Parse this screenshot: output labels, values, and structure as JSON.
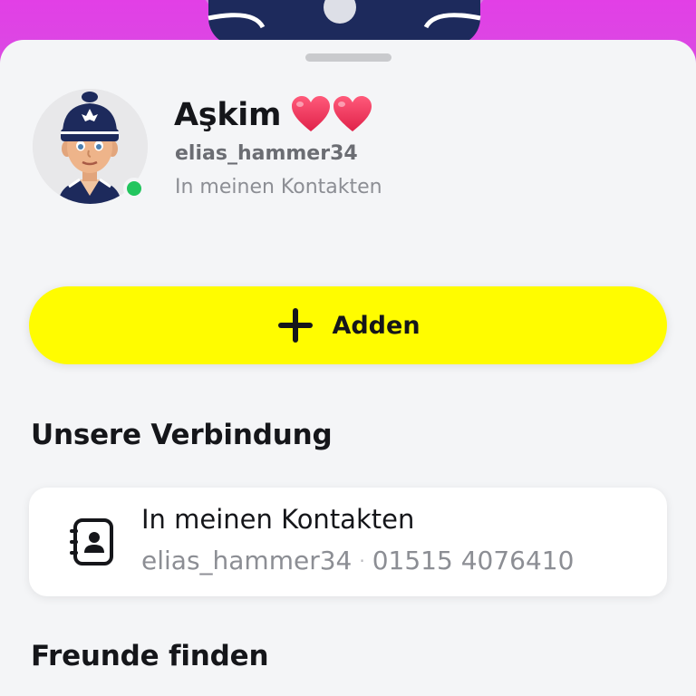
{
  "profile": {
    "display_name": "Aşkim",
    "hearts": "❤️❤️",
    "username": "elias_hammer34",
    "status": "In meinen Kontakten",
    "online_color": "#22c55e"
  },
  "add_button": {
    "label": "Adden",
    "icon": "plus-icon",
    "color": "#fffc00"
  },
  "connection": {
    "title": "Unsere Verbindung",
    "card": {
      "icon": "contacts-book-icon",
      "title": "In meinen Kontakten",
      "username": "elias_hammer34",
      "separator": "·",
      "phone": "01515 4076410"
    }
  },
  "find_friends": {
    "title": "Freunde finden"
  },
  "colors": {
    "header_background": "#e23fe6",
    "sheet_background": "#f4f5f7"
  }
}
